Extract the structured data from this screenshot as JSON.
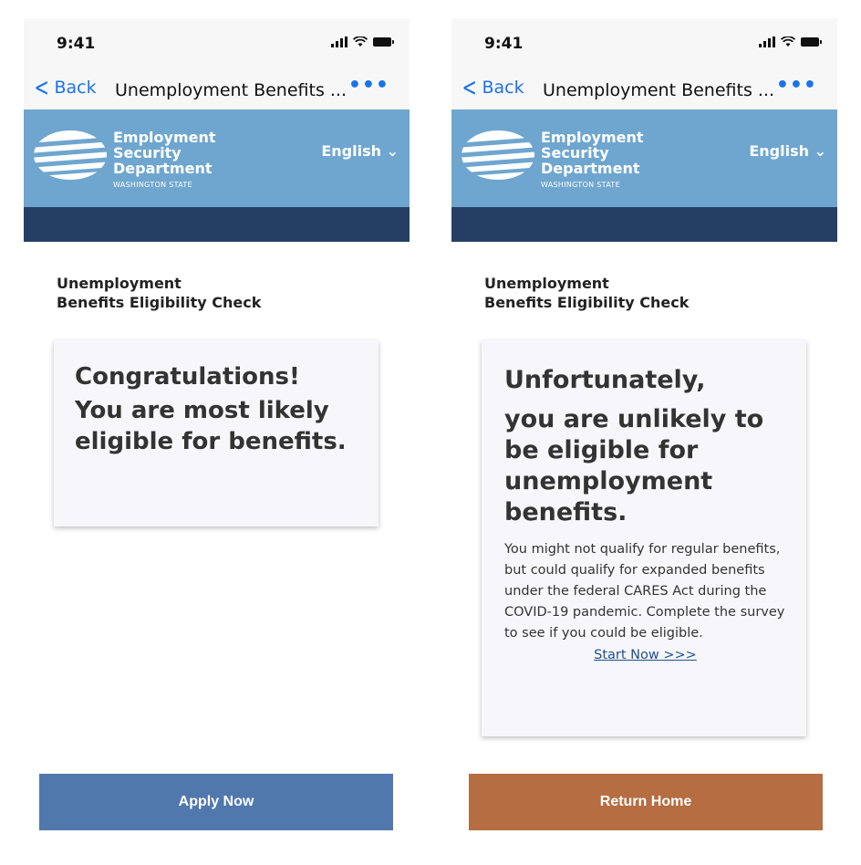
{
  "screens": [
    {
      "status": {
        "time": "9:41"
      },
      "nav": {
        "back_label": "Back",
        "title": "Unemployment Benefits ...",
        "more": "•••"
      },
      "brand": {
        "line1": "Employment",
        "line2": "Security",
        "line3": "Department",
        "sub": "WASHINGTON STATE",
        "language": "English ⌄"
      },
      "page_title_line1": "Unemployment",
      "page_title_line2": "Benefits Eligibility Check",
      "card": {
        "heading": "Congratulations!",
        "subheading": "You are most likely eligible for benefits."
      },
      "cta_label": "Apply Now"
    },
    {
      "status": {
        "time": "9:41"
      },
      "nav": {
        "back_label": "Back",
        "title": "Unemployment Benefits ...",
        "more": "•••"
      },
      "brand": {
        "line1": "Employment",
        "line2": "Security",
        "line3": "Department",
        "sub": "WASHINGTON STATE",
        "language": "English ⌄"
      },
      "page_title_line1": "Unemployment",
      "page_title_line2": "Benefits Eligibility Check",
      "card": {
        "heading": "Unfortunately,",
        "subheading": "you are unlikely to be eligible for unemployment benefits.",
        "body": "You might not qualify for regular benefits, but could qualify for expanded benefits under the federal CARES Act during the COVID-19 pandemic. Complete the survey to see if you could be eligible.",
        "link": "Start Now >>>"
      },
      "cta_label": "Return Home"
    }
  ],
  "colors": {
    "brand_blue": "#6fa6cf",
    "navy_bar": "#243f63",
    "apply_button": "#5078ac",
    "return_button": "#b56d41",
    "ios_blue": "#1a73e8"
  }
}
